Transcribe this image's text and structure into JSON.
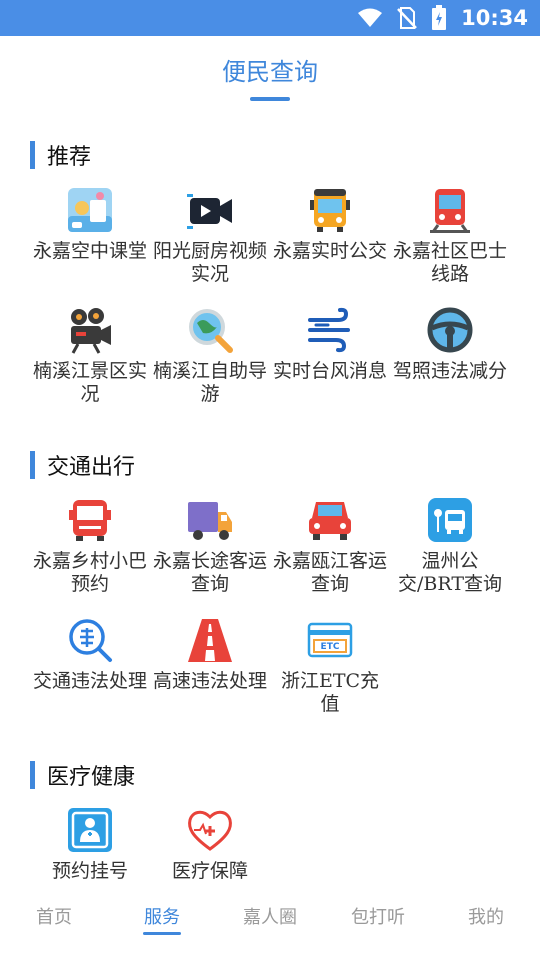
{
  "status_bar": {
    "time": "10:34"
  },
  "header": {
    "title": "便民查询"
  },
  "sections": [
    {
      "title": "推荐",
      "items": [
        {
          "label": "永嘉空中课堂",
          "icon": "classroom-icon"
        },
        {
          "label": "阳光厨房视频实况",
          "icon": "video-camera-icon"
        },
        {
          "label": "永嘉实时公交",
          "icon": "bus-icon"
        },
        {
          "label": "永嘉社区巴士线路",
          "icon": "shuttle-bus-icon"
        },
        {
          "label": "楠溪江景区实况",
          "icon": "movie-camera-icon"
        },
        {
          "label": "楠溪江自助导游",
          "icon": "globe-search-icon"
        },
        {
          "label": "实时台风消息",
          "icon": "wind-icon"
        },
        {
          "label": "驾照违法减分",
          "icon": "steering-wheel-icon"
        }
      ]
    },
    {
      "title": "交通出行",
      "items": [
        {
          "label": "永嘉乡村小巴预约",
          "icon": "minibus-icon"
        },
        {
          "label": "永嘉长途客运查询",
          "icon": "truck-icon"
        },
        {
          "label": "永嘉瓯江客运查询",
          "icon": "car-icon"
        },
        {
          "label": "温州公交/BRT查询",
          "icon": "bus-stop-icon"
        },
        {
          "label": "交通违法处理",
          "icon": "violation-search-icon"
        },
        {
          "label": "高速违法处理",
          "icon": "highway-icon"
        },
        {
          "label": "浙江ETC充值",
          "icon": "etc-card-icon"
        }
      ]
    },
    {
      "title": "医疗健康",
      "items": [
        {
          "label": "预约挂号",
          "icon": "doctor-icon"
        },
        {
          "label": "医疗保障",
          "icon": "heart-plus-icon"
        }
      ]
    }
  ],
  "bottom_nav": {
    "tabs": [
      "首页",
      "服务",
      "嘉人圈",
      "包打听",
      "我的"
    ],
    "active": "服务"
  },
  "colors": {
    "accent": "#3f87db",
    "status_bar": "#4a8ee6",
    "inactive_tab": "#9a9a9a"
  }
}
